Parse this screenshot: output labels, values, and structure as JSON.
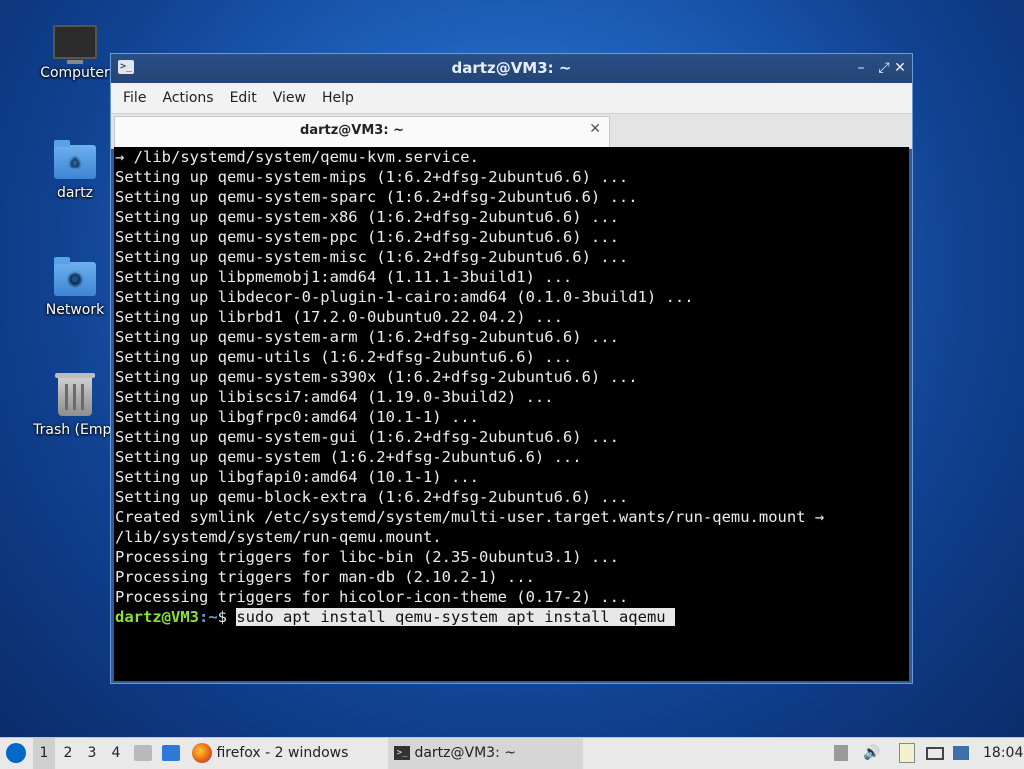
{
  "desktop": {
    "icons": [
      {
        "label": "Computer"
      },
      {
        "label": "dartz"
      },
      {
        "label": "Network"
      },
      {
        "label": "Trash (Empt"
      }
    ]
  },
  "window": {
    "title": "dartz@VM3: ~",
    "menu": [
      "File",
      "Actions",
      "Edit",
      "View",
      "Help"
    ],
    "tab_label": "dartz@VM3: ~",
    "terminal_lines": [
      "→ /lib/systemd/system/qemu-kvm.service.",
      "Setting up qemu-system-mips (1:6.2+dfsg-2ubuntu6.6) ...",
      "Setting up qemu-system-sparc (1:6.2+dfsg-2ubuntu6.6) ...",
      "Setting up qemu-system-x86 (1:6.2+dfsg-2ubuntu6.6) ...",
      "Setting up qemu-system-ppc (1:6.2+dfsg-2ubuntu6.6) ...",
      "Setting up qemu-system-misc (1:6.2+dfsg-2ubuntu6.6) ...",
      "Setting up libpmemobj1:amd64 (1.11.1-3build1) ...",
      "Setting up libdecor-0-plugin-1-cairo:amd64 (0.1.0-3build1) ...",
      "Setting up librbd1 (17.2.0-0ubuntu0.22.04.2) ...",
      "Setting up qemu-system-arm (1:6.2+dfsg-2ubuntu6.6) ...",
      "Setting up qemu-utils (1:6.2+dfsg-2ubuntu6.6) ...",
      "Setting up qemu-system-s390x (1:6.2+dfsg-2ubuntu6.6) ...",
      "Setting up libiscsi7:amd64 (1.19.0-3build2) ...",
      "Setting up libgfrpc0:amd64 (10.1-1) ...",
      "Setting up qemu-system-gui (1:6.2+dfsg-2ubuntu6.6) ...",
      "Setting up qemu-system (1:6.2+dfsg-2ubuntu6.6) ...",
      "Setting up libgfapi0:amd64 (10.1-1) ...",
      "Setting up qemu-block-extra (1:6.2+dfsg-2ubuntu6.6) ...",
      "Created symlink /etc/systemd/system/multi-user.target.wants/run-qemu.mount →",
      "/lib/systemd/system/run-qemu.mount.",
      "Processing triggers for libc-bin (2.35-0ubuntu3.1) ...",
      "Processing triggers for man-db (2.10.2-1) ...",
      "Processing triggers for hicolor-icon-theme (0.17-2) ..."
    ],
    "prompt": {
      "user": "dartz@VM3",
      "path": ":~",
      "symbol": "$ ",
      "command": "sudo apt install qemu-system apt install aqemu "
    }
  },
  "taskbar": {
    "workspaces": [
      "1",
      "2",
      "3",
      "4"
    ],
    "firefox_label": "firefox - 2 windows",
    "terminal_label": "dartz@VM3: ~",
    "clock": "18:04"
  }
}
